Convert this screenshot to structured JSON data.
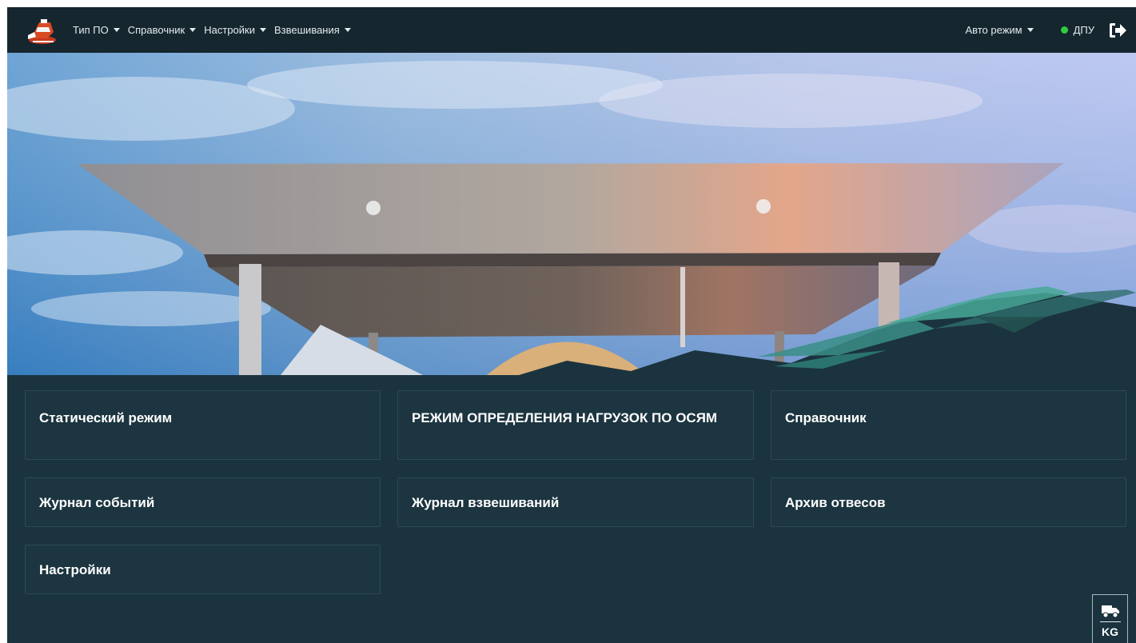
{
  "navbar": {
    "logo_icon": "scale-truck-logo-icon",
    "menu": [
      {
        "label": "Тип ПО",
        "icon": "caret-down-icon"
      },
      {
        "label": "Справочник",
        "icon": "caret-down-icon"
      },
      {
        "label": "Настройки",
        "icon": "caret-down-icon"
      },
      {
        "label": "Взвешивания",
        "icon": "caret-down-icon"
      }
    ],
    "mode": {
      "label": "Авто режим",
      "icon": "caret-down-icon"
    },
    "status": {
      "label": "ДПУ",
      "color": "#2ecc40"
    },
    "logout_icon": "logout-icon"
  },
  "hero": {
    "image": "weighbridge-canopy-photo"
  },
  "tiles": [
    {
      "label": "Статический режим"
    },
    {
      "label": "РЕЖИМ ОПРЕДЕЛЕНИЯ НАГРУЗОК ПО ОСЯМ"
    },
    {
      "label": "Справочник"
    },
    {
      "label": "Журнал событий"
    },
    {
      "label": "Журнал взвешиваний"
    },
    {
      "label": "Архив отвесов"
    },
    {
      "label": "Настройки"
    }
  ],
  "unit_badge": {
    "icon": "truck-icon",
    "label": "KG"
  },
  "colors": {
    "background": "#1b333e",
    "navbar": "#15262f",
    "tile_border": "#2e4955",
    "accent_teal": "#3a8e87",
    "status_green": "#2ecc40"
  }
}
